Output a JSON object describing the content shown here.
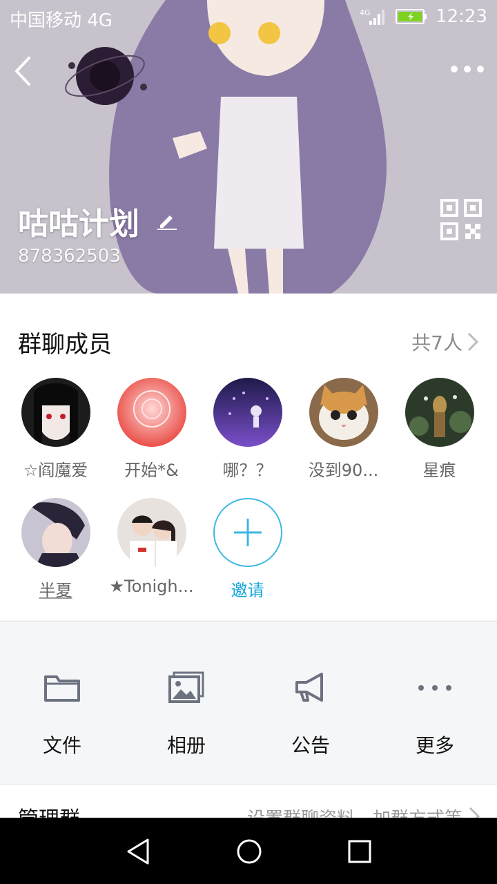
{
  "status": {
    "carrier": "中国移动 4G",
    "network": "4G",
    "time": "12:23"
  },
  "header": {
    "group_name": "咕咕计划",
    "group_id": "878362503"
  },
  "members": {
    "title": "群聊成员",
    "count_label": "共7人",
    "list": [
      {
        "name": "☆阎魔爱",
        "color": "#2a2a2a"
      },
      {
        "name": "开始*&",
        "color": "#f04a4a"
      },
      {
        "name": "哪？？",
        "color": "#3b2d7a"
      },
      {
        "name": "没到90...",
        "color": "#d9b07a"
      },
      {
        "name": "星痕",
        "color": "#3e4a38"
      },
      {
        "name": "半夏",
        "color": "#4b4a6a"
      },
      {
        "name": "★Tonigh...",
        "color": "#d9c3b7"
      }
    ],
    "invite_label": "邀请"
  },
  "actions": [
    {
      "label": "文件",
      "icon": "folder-icon"
    },
    {
      "label": "相册",
      "icon": "album-icon"
    },
    {
      "label": "公告",
      "icon": "megaphone-icon"
    },
    {
      "label": "更多",
      "icon": "more-dots-icon"
    }
  ],
  "manage": {
    "title": "管理群",
    "desc": "设置群聊资料、加群方式等"
  },
  "colors": {
    "accent": "#12a5db",
    "invite_border": "#3db7e4"
  }
}
